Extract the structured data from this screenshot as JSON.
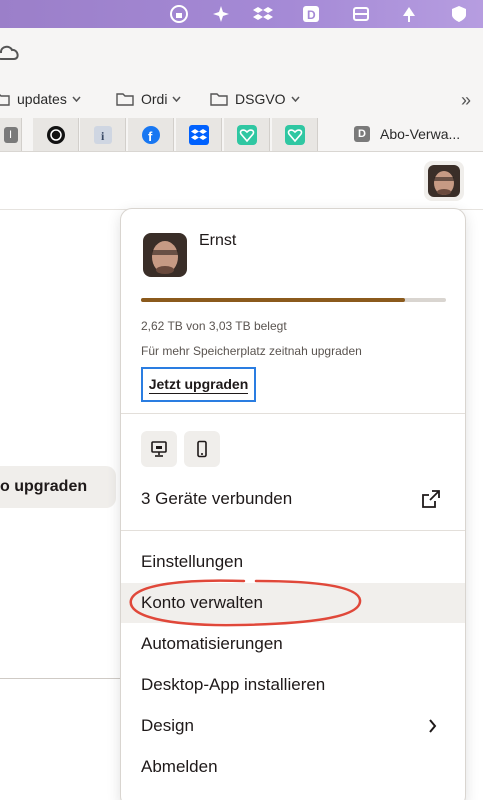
{
  "bookmarks": [
    {
      "label": "updates"
    },
    {
      "label": "Ordi"
    },
    {
      "label": "DSGVO"
    }
  ],
  "tabs": {
    "active_label": "Abo-Verwa...",
    "active_badge": "D",
    "first_badge": "I"
  },
  "background": {
    "upgrade_button": "o upgraden"
  },
  "account_menu": {
    "user_name": "Ernst",
    "storage_used_fraction": 0.865,
    "storage_text": "2,62 TB von 3,03 TB belegt",
    "storage_hint": "Für mehr Speicherplatz zeitnah upgraden",
    "upgrade_link": "Jetzt upgraden",
    "devices_text": "3 Geräte verbunden",
    "items": [
      {
        "label": "Einstellungen"
      },
      {
        "label": "Konto verwalten"
      },
      {
        "label": "Automatisierungen"
      },
      {
        "label": "Desktop-App installieren"
      },
      {
        "label": "Design"
      },
      {
        "label": "Abmelden"
      }
    ]
  },
  "colors": {
    "storage_fill": "#8b5a1c",
    "focus_ring": "#2a7de1",
    "annotation": "#e0483a",
    "menubar": "#a58ad6"
  },
  "icons": [
    "cloud-icon",
    "folder-icon",
    "chevron-down-icon",
    "double-chevron-icon",
    "monitor-icon",
    "phone-icon",
    "external-link-icon",
    "chevron-right-icon"
  ]
}
